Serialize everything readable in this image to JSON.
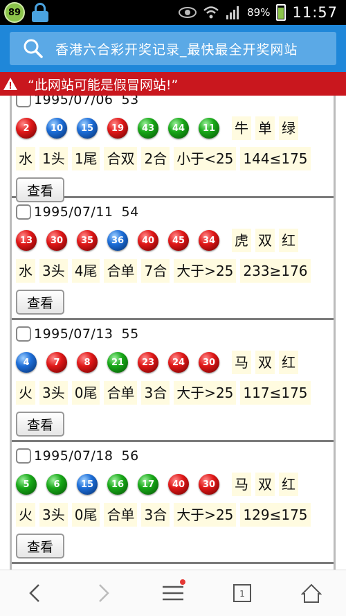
{
  "status": {
    "badge": "89",
    "battery_pct": "89%",
    "time": "11:57"
  },
  "address": {
    "text": "香港六合彩开奖记录_最快最全开奖网站"
  },
  "warning": {
    "text": "“此网站可能是假冒网站!”"
  },
  "colors": {
    "address_bar": "#1f87d9",
    "warning_bar": "#c9171e",
    "ball_red": "#e01818",
    "ball_blue": "#1d6ed8",
    "ball_green": "#18a818"
  },
  "records": [
    {
      "date": "1995/07/06",
      "issue": "53",
      "balls": [
        {
          "n": "2",
          "c": "red"
        },
        {
          "n": "10",
          "c": "blue"
        },
        {
          "n": "15",
          "c": "blue"
        },
        {
          "n": "19",
          "c": "red"
        },
        {
          "n": "43",
          "c": "green"
        },
        {
          "n": "44",
          "c": "green"
        },
        {
          "n": "11",
          "c": "green"
        }
      ],
      "zodiac": "牛",
      "parity": "单",
      "wave": "绿",
      "element": "水",
      "head": "1头",
      "tail": "1尾",
      "combo_parity": "合双",
      "combo": "2合",
      "size": "小于<25",
      "sum": "144≤175",
      "view": "查看"
    },
    {
      "date": "1995/07/11",
      "issue": "54",
      "balls": [
        {
          "n": "13",
          "c": "red"
        },
        {
          "n": "30",
          "c": "red"
        },
        {
          "n": "35",
          "c": "red"
        },
        {
          "n": "36",
          "c": "blue"
        },
        {
          "n": "40",
          "c": "red"
        },
        {
          "n": "45",
          "c": "red"
        },
        {
          "n": "34",
          "c": "red"
        }
      ],
      "zodiac": "虎",
      "parity": "双",
      "wave": "红",
      "element": "水",
      "head": "3头",
      "tail": "4尾",
      "combo_parity": "合单",
      "combo": "7合",
      "size": "大于>25",
      "sum": "233≥176",
      "view": "查看"
    },
    {
      "date": "1995/07/13",
      "issue": "55",
      "balls": [
        {
          "n": "4",
          "c": "blue"
        },
        {
          "n": "7",
          "c": "red"
        },
        {
          "n": "8",
          "c": "red"
        },
        {
          "n": "21",
          "c": "green"
        },
        {
          "n": "23",
          "c": "red"
        },
        {
          "n": "24",
          "c": "red"
        },
        {
          "n": "30",
          "c": "red"
        }
      ],
      "zodiac": "马",
      "parity": "双",
      "wave": "红",
      "element": "火",
      "head": "3头",
      "tail": "0尾",
      "combo_parity": "合单",
      "combo": "3合",
      "size": "大于>25",
      "sum": "117≤175",
      "view": "查看"
    },
    {
      "date": "1995/07/18",
      "issue": "56",
      "balls": [
        {
          "n": "5",
          "c": "green"
        },
        {
          "n": "6",
          "c": "green"
        },
        {
          "n": "15",
          "c": "blue"
        },
        {
          "n": "16",
          "c": "green"
        },
        {
          "n": "17",
          "c": "green"
        },
        {
          "n": "40",
          "c": "red"
        },
        {
          "n": "30",
          "c": "red"
        }
      ],
      "zodiac": "马",
      "parity": "双",
      "wave": "红",
      "element": "火",
      "head": "3头",
      "tail": "0尾",
      "combo_parity": "合单",
      "combo": "3合",
      "size": "大于>25",
      "sum": "129≤175",
      "view": "查看"
    }
  ]
}
